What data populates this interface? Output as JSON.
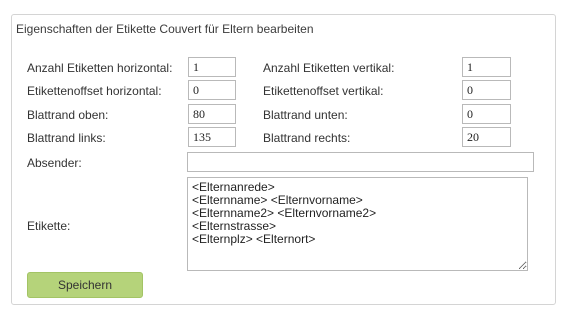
{
  "panel": {
    "title": "Eigenschaften der Etikette Couvert für Eltern bearbeiten"
  },
  "fields": {
    "anzahl_horizontal": {
      "label": "Anzahl Etiketten horizontal:",
      "value": "1"
    },
    "anzahl_vertikal": {
      "label": "Anzahl Etiketten vertikal:",
      "value": "1"
    },
    "offset_horizontal": {
      "label": "Etikettenoffset horizontal:",
      "value": "0"
    },
    "offset_vertikal": {
      "label": "Etikettenoffset vertikal:",
      "value": "0"
    },
    "blattrand_oben": {
      "label": "Blattrand oben:",
      "value": "80"
    },
    "blattrand_unten": {
      "label": "Blattrand unten:",
      "value": "0"
    },
    "blattrand_links": {
      "label": "Blattrand links:",
      "value": "135"
    },
    "blattrand_rechts": {
      "label": "Blattrand rechts:",
      "value": "20"
    },
    "absender": {
      "label": "Absender:",
      "value": ""
    },
    "etikette": {
      "label": "Etikette:",
      "value": "<Elternanrede>\n<Elternname> <Elternvorname>\n<Elternname2> <Elternvorname2>\n<Elternstrasse>\n<Elternplz> <Elternort>"
    }
  },
  "actions": {
    "save_label": "Speichern"
  },
  "colors": {
    "save_button_bg": "#b5d37a",
    "panel_border": "#d4d4d4"
  }
}
